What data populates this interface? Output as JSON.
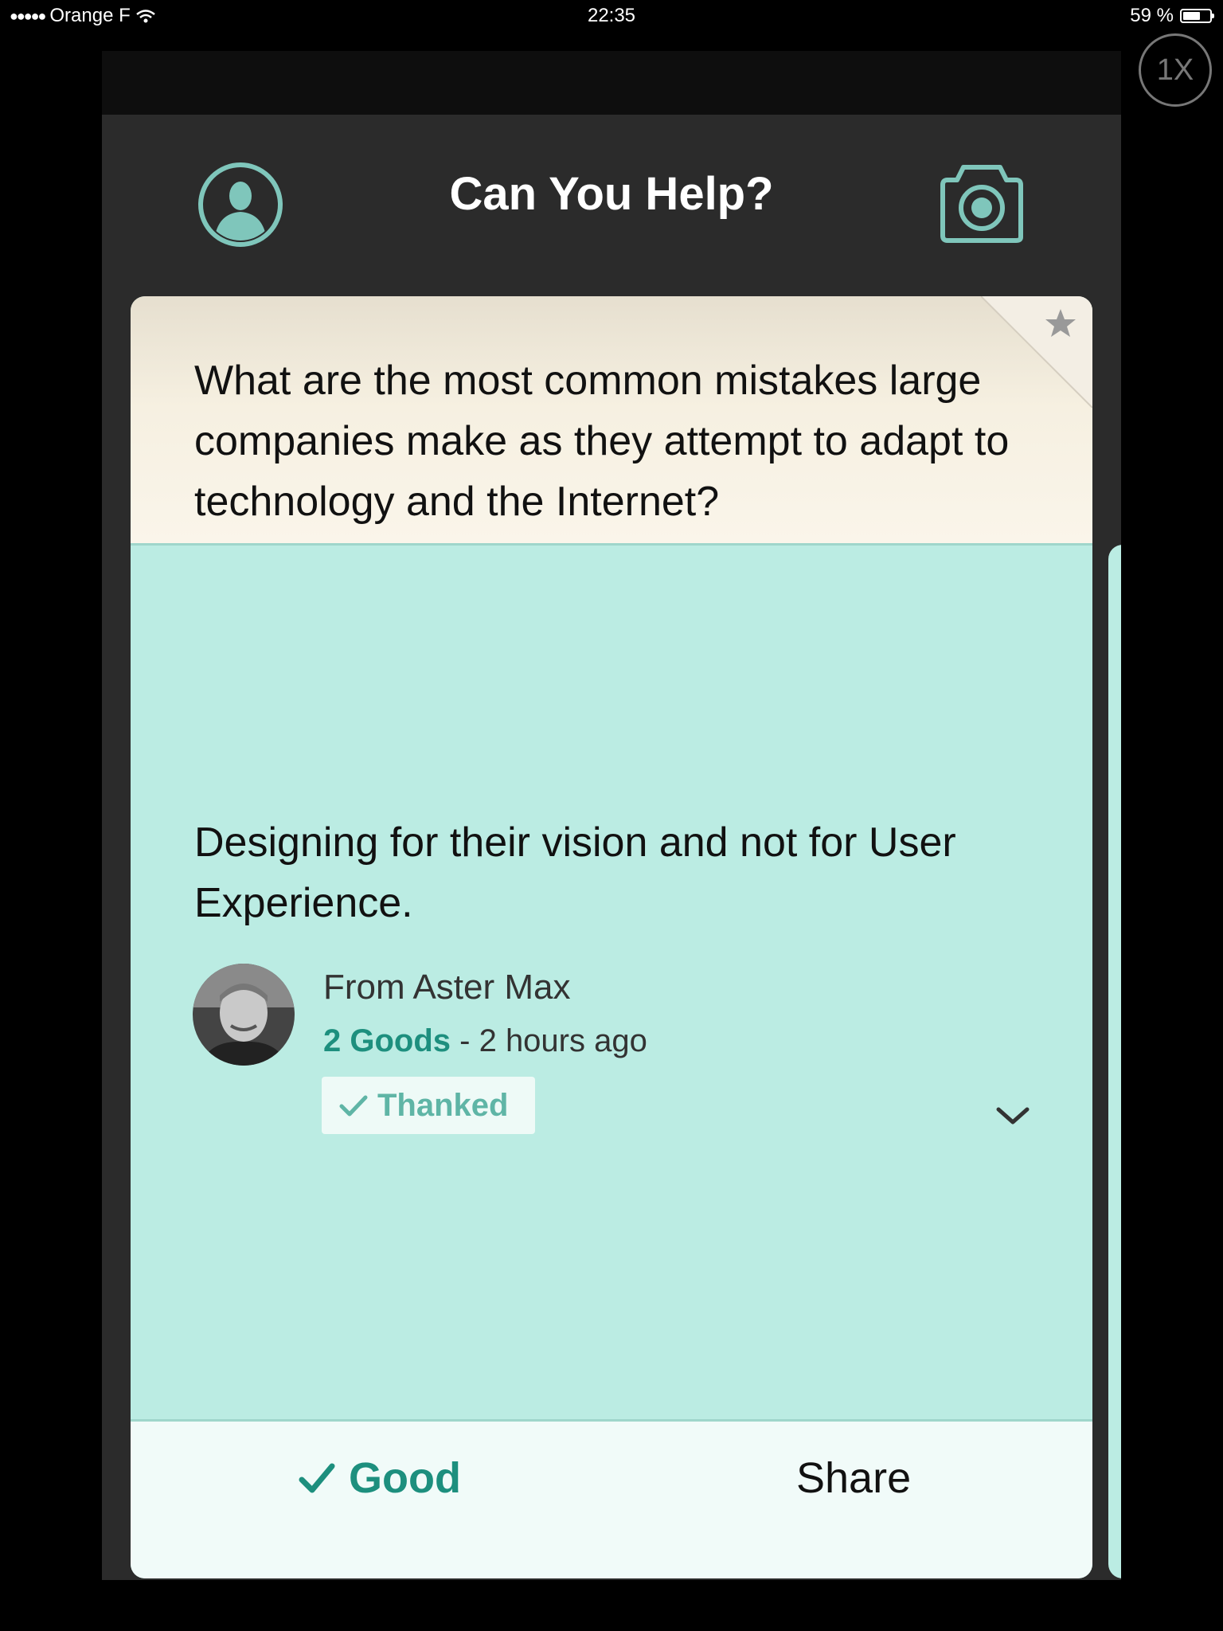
{
  "status_bar": {
    "carrier": "Orange F",
    "time": "22:35",
    "battery_percent": "59 %",
    "battery_level": 0.59
  },
  "zoom": {
    "label": "1X"
  },
  "header": {
    "title": "Can You Help?",
    "left_icon": "profile-icon",
    "right_icon": "camera-icon"
  },
  "question": {
    "text": "What are the most common mistakes large companies make as they attempt to adapt to technology and the Internet?",
    "icon": "star-icon"
  },
  "answer": {
    "text": "Designing for their vision and not for User Experience.",
    "author": "From Aster Max",
    "goods": "2 Goods",
    "time": " - 2 hours ago",
    "thanked_label": "Thanked"
  },
  "footer": {
    "good_label": "Good",
    "share_label": "Share"
  },
  "colors": {
    "accent": "#1d8f7e",
    "answer_bg": "#bbece3",
    "icon_teal": "#7fc6bb",
    "app_bg": "#2b2b2b"
  }
}
